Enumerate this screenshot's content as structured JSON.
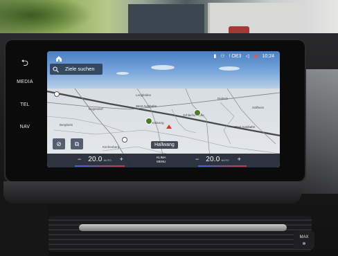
{
  "side_buttons": {
    "back_label": "⮌",
    "media_label": "MEDIA",
    "tel_label": "TEL",
    "nav_label": "NAV"
  },
  "display": {
    "search": {
      "label": "Ziele suchen",
      "icon": "search-icon"
    },
    "home_icon": "home-icon",
    "status": {
      "network": "! OE3",
      "time": "10:24"
    },
    "map": {
      "labels": [
        {
          "text": "West Autobahn"
        },
        {
          "text": "West Autobahn"
        },
        {
          "text": "Hallwang"
        },
        {
          "text": "Kirchenberg"
        },
        {
          "text": "Lengfelden"
        },
        {
          "text": "Radeck"
        },
        {
          "text": "Söllheim"
        },
        {
          "text": "Eugendorf"
        },
        {
          "text": "Schlachtbrücke"
        },
        {
          "text": "Bergheim"
        }
      ],
      "place_chip": "Hallwang"
    },
    "climate": {
      "left_temp": "20.0",
      "left_unit": "AUTO",
      "right_temp": "20.0",
      "right_unit": "AUTO",
      "minus": "−",
      "plus": "+",
      "klima_line1": "KLIMA",
      "klima_line2": "MENU"
    }
  },
  "console": {
    "max_line1": "MAX",
    "max_line2": "❄"
  },
  "colors": {
    "sky_top": "#4a7fc4",
    "climate_bar": "#242a36",
    "poi_green": "#4d7a2a",
    "position_red": "#d23a2a"
  }
}
